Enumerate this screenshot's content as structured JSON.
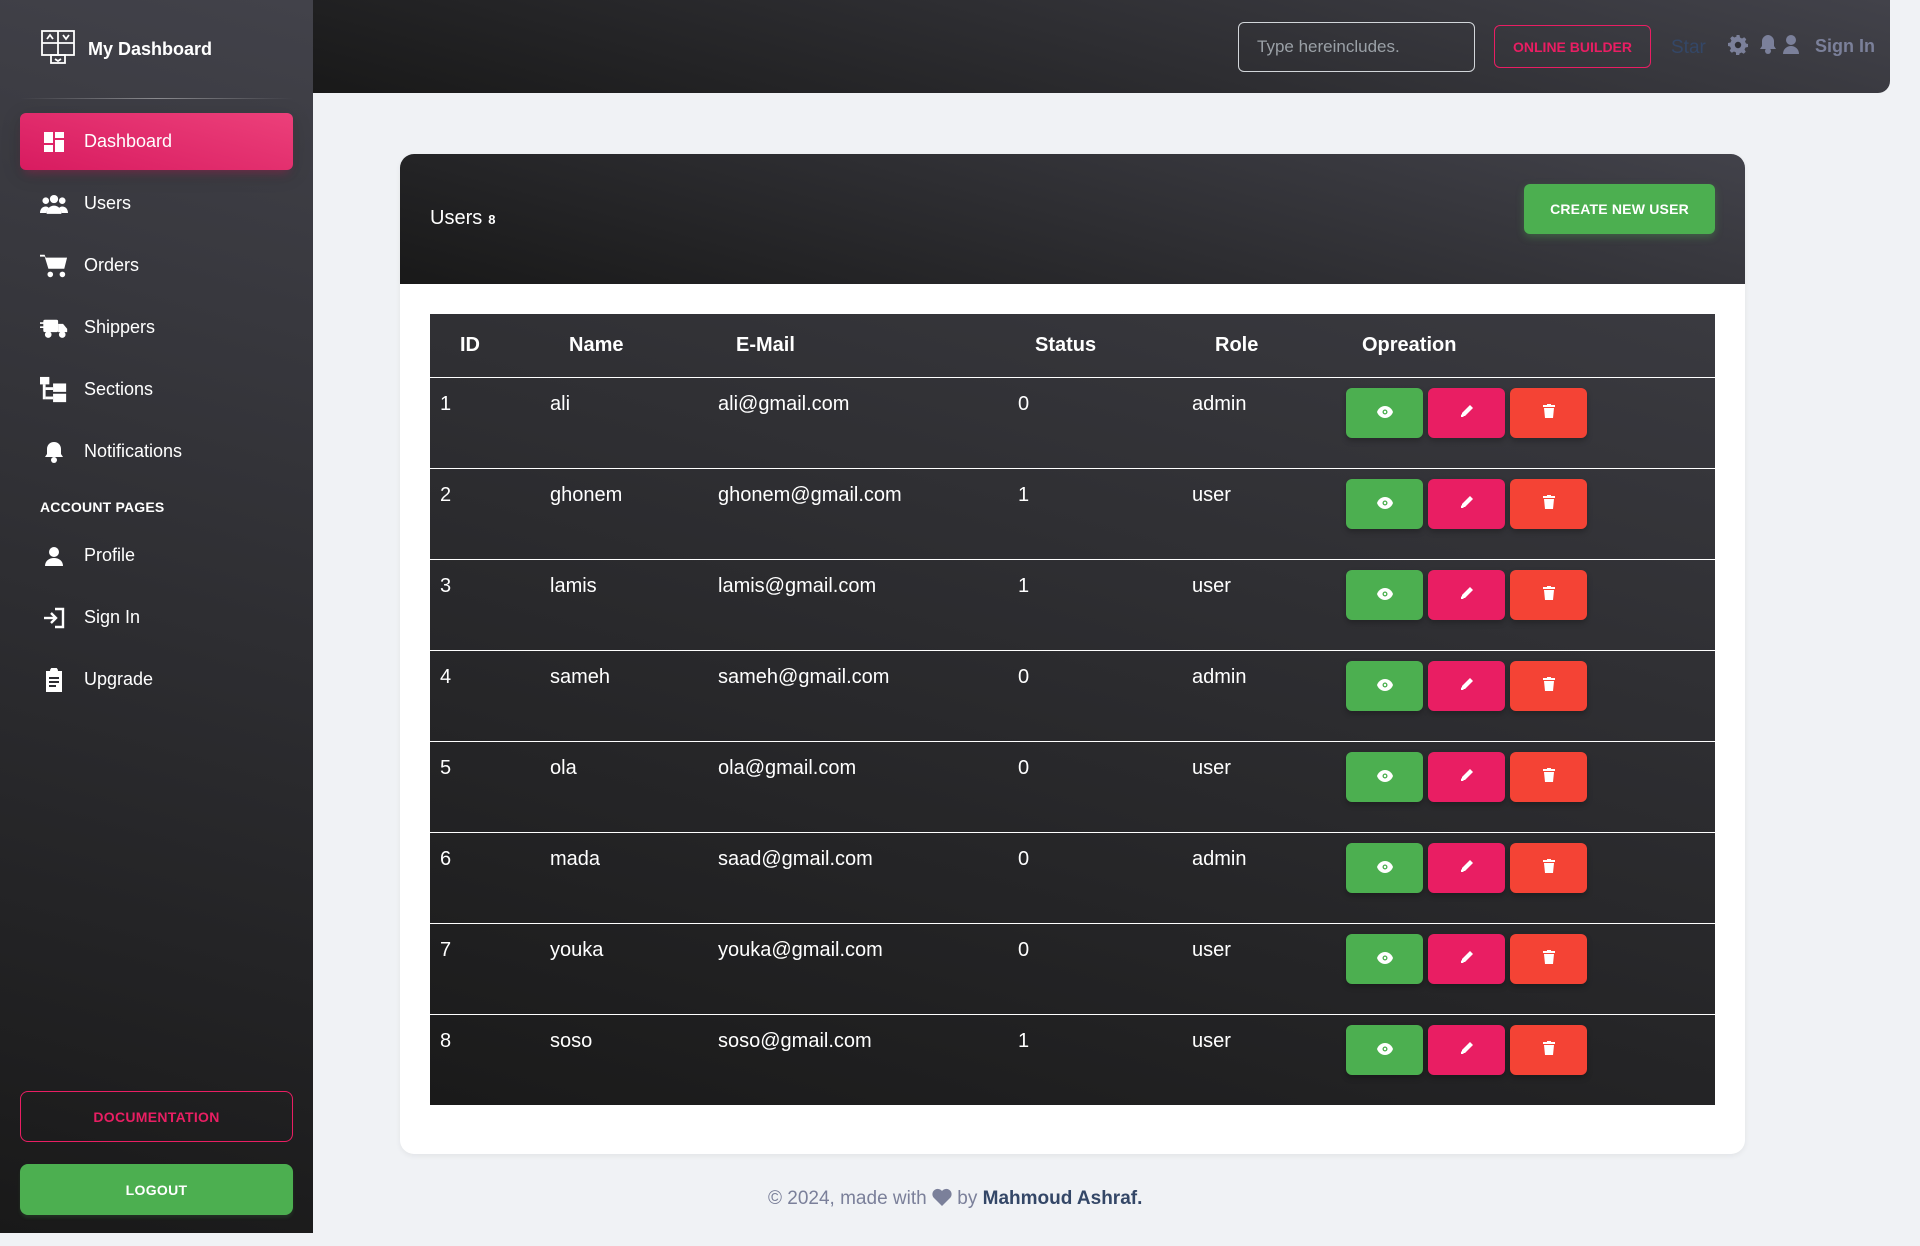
{
  "brand": {
    "name": "My Dashboard",
    "icon": "grid-layout-icon"
  },
  "sidebar": {
    "items": [
      {
        "label": "Dashboard",
        "icon": "dashboard-icon",
        "active": true
      },
      {
        "label": "Users",
        "icon": "users-icon"
      },
      {
        "label": "Orders",
        "icon": "cart-icon"
      },
      {
        "label": "Shippers",
        "icon": "truck-icon"
      },
      {
        "label": "Sections",
        "icon": "sections-icon"
      },
      {
        "label": "Notifications",
        "icon": "bell-icon"
      }
    ],
    "section_label": "ACCOUNT PAGES",
    "account_items": [
      {
        "label": "Profile",
        "icon": "person-icon"
      },
      {
        "label": "Sign In",
        "icon": "login-icon"
      },
      {
        "label": "Upgrade",
        "icon": "clipboard-icon"
      }
    ],
    "documentation_label": "DOCUMENTATION",
    "logout_label": "LOGOUT"
  },
  "topbar": {
    "search_placeholder": "Type hereincludes.",
    "online_builder_label": "ONLINE BUILDER",
    "star_label": "Star",
    "signin_label": "Sign In"
  },
  "card": {
    "title": "Users",
    "count": "8",
    "create_label": "CREATE NEW USER"
  },
  "table": {
    "headers": [
      "ID",
      "Name",
      "E-Mail",
      "Status",
      "Role",
      "Opreation"
    ],
    "rows": [
      {
        "id": "1",
        "name": "ali",
        "email": "ali@gmail.com",
        "status": "0",
        "role": "admin"
      },
      {
        "id": "2",
        "name": "ghonem",
        "email": "ghonem@gmail.com",
        "status": "1",
        "role": "user"
      },
      {
        "id": "3",
        "name": "lamis",
        "email": "lamis@gmail.com",
        "status": "1",
        "role": "user"
      },
      {
        "id": "4",
        "name": "sameh",
        "email": "sameh@gmail.com",
        "status": "0",
        "role": "admin"
      },
      {
        "id": "5",
        "name": "ola",
        "email": "ola@gmail.com",
        "status": "0",
        "role": "user"
      },
      {
        "id": "6",
        "name": "mada",
        "email": "saad@gmail.com",
        "status": "0",
        "role": "admin"
      },
      {
        "id": "7",
        "name": "youka",
        "email": "youka@gmail.com",
        "status": "0",
        "role": "user"
      },
      {
        "id": "8",
        "name": "soso",
        "email": "soso@gmail.com",
        "status": "1",
        "role": "user"
      }
    ]
  },
  "footer": {
    "prefix": "© 2024, made with",
    "by": "by",
    "author": "Mahmoud Ashraf."
  },
  "colors": {
    "primary": "#e91e63",
    "success": "#4caf50",
    "danger": "#f44335",
    "dark": "#191919"
  }
}
